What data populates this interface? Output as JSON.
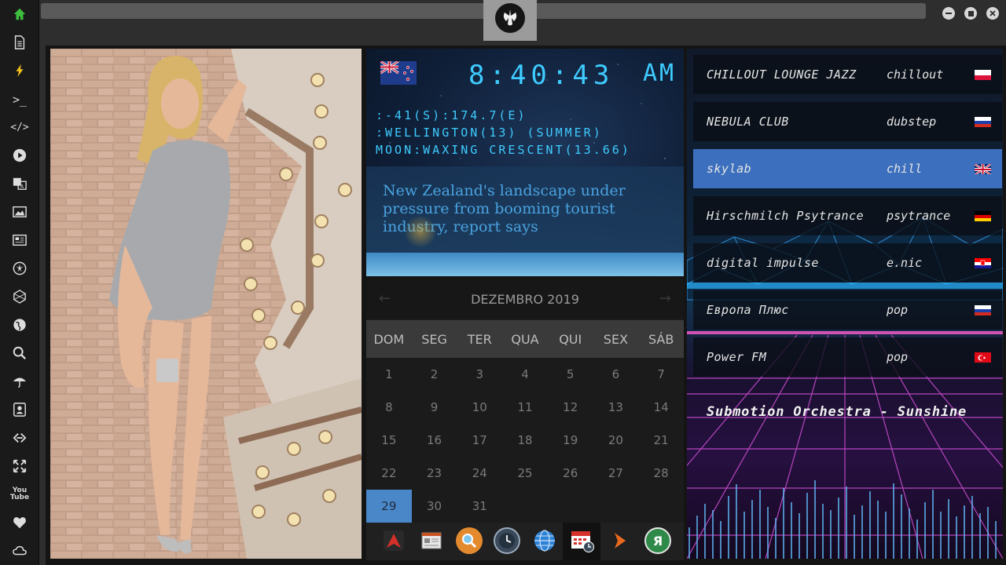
{
  "sidebar": {
    "items": [
      {
        "name": "home-icon"
      },
      {
        "name": "document-icon"
      },
      {
        "name": "lightning-icon"
      },
      {
        "name": "terminal-icon",
        "glyph": ">_"
      },
      {
        "name": "code-icon",
        "glyph": "</>"
      },
      {
        "name": "play-icon"
      },
      {
        "name": "translate-icon"
      },
      {
        "name": "image-icon"
      },
      {
        "name": "news-icon"
      },
      {
        "name": "rebel-icon"
      },
      {
        "name": "hexagon-icon"
      },
      {
        "name": "globe-icon"
      },
      {
        "name": "search-icon"
      },
      {
        "name": "umbrella-icon"
      },
      {
        "name": "contact-icon"
      },
      {
        "name": "link-icon"
      },
      {
        "name": "expand-icon"
      },
      {
        "name": "youtube-icon",
        "glyph": "You Tube"
      },
      {
        "name": "heart-icon"
      },
      {
        "name": "cloud-icon"
      }
    ],
    "active_color": "#3fbf3f"
  },
  "clock": {
    "time": "8:40:43",
    "ampm": "AM",
    "coords": ":-41(S):174.7(E)",
    "location": ":WELLINGTON(13) (SUMMER)",
    "moon": "MOON:WAXING CRESCENT(13.66)",
    "news": "New Zealand's landscape under pressure from booming tourist industry, report says",
    "digit_color": "#3ecbff"
  },
  "calendar": {
    "month": "DEZEMBRO 2019",
    "weekdays": [
      "DOM",
      "SEG",
      "TER",
      "QUA",
      "QUI",
      "SEX",
      "SÁB"
    ],
    "days": [
      "1",
      "2",
      "3",
      "4",
      "5",
      "6",
      "7",
      "8",
      "9",
      "10",
      "11",
      "12",
      "13",
      "14",
      "15",
      "16",
      "17",
      "18",
      "19",
      "20",
      "21",
      "22",
      "23",
      "24",
      "25",
      "26",
      "27",
      "28",
      "29",
      "30",
      "31"
    ],
    "today": "29",
    "today_color": "#4a87c8"
  },
  "dock": {
    "items": [
      "arrow-app-icon",
      "browser-window-icon",
      "search-app-icon",
      "clock-app-icon",
      "globe-app-icon",
      "calendar-app-icon",
      "play-arrow-icon",
      "yandex-icon"
    ],
    "yandex_glyph": "Я"
  },
  "radio": {
    "stations": [
      {
        "name": "CHILLOUT LOUNGE JAZZ",
        "genre": "chillout",
        "flag": "poland"
      },
      {
        "name": "NEBULA CLUB",
        "genre": "dubstep",
        "flag": "russia"
      },
      {
        "name": "skylab",
        "genre": "chill",
        "flag": "uk",
        "selected": true
      },
      {
        "name": "Hirschmilch Psytrance",
        "genre": "psytrance",
        "flag": "germany"
      },
      {
        "name": "digital impulse",
        "genre": "e.nic",
        "flag": "croatia"
      },
      {
        "name": "Европа Плюс",
        "genre": "pop",
        "flag": "russia"
      },
      {
        "name": "Power FM",
        "genre": "pop",
        "flag": "turkey"
      }
    ],
    "now_playing": "Submotion Orchestra - Sunshine",
    "selected_color": "#3c6fbd"
  }
}
